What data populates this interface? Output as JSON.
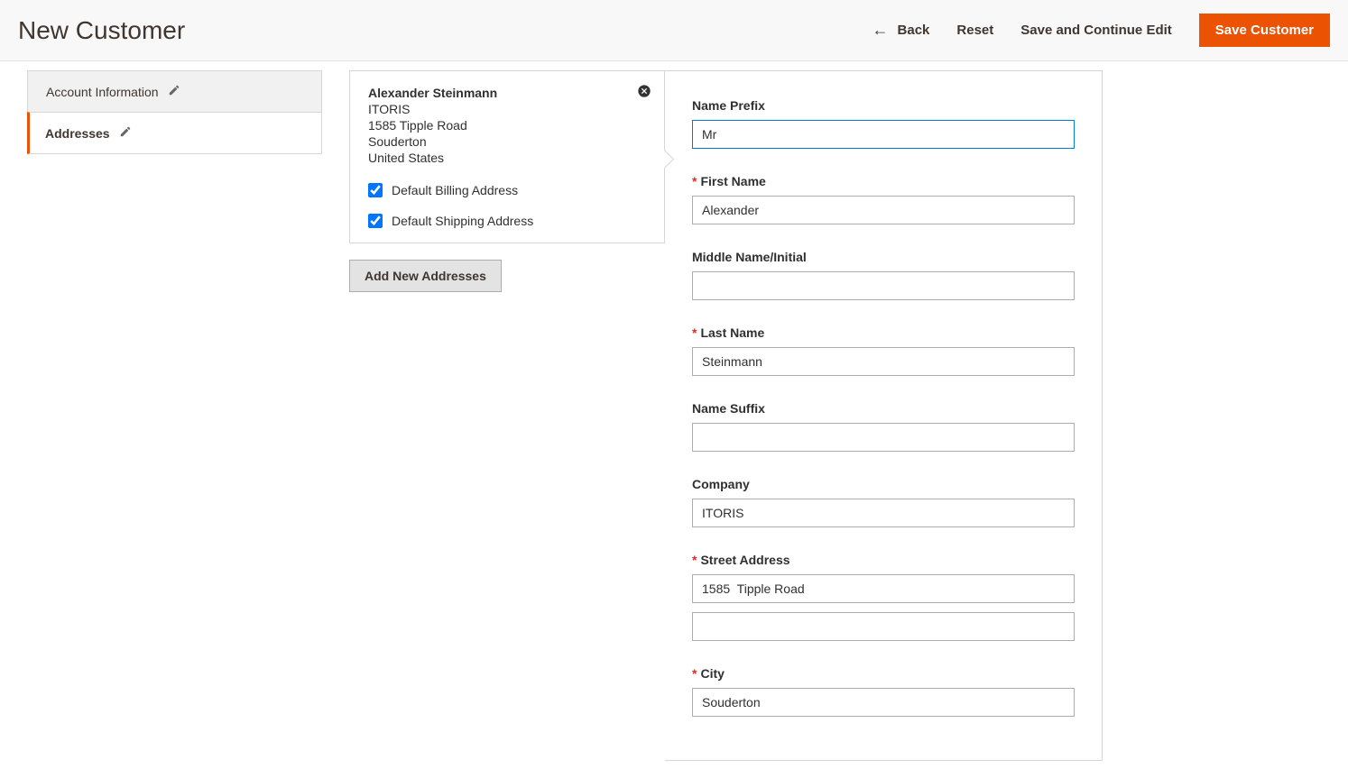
{
  "header": {
    "title": "New Customer",
    "actions": {
      "back": "Back",
      "reset": "Reset",
      "save_continue": "Save and Continue Edit",
      "save": "Save Customer"
    }
  },
  "sidebar": {
    "items": [
      {
        "label": "Account Information"
      },
      {
        "label": "Addresses"
      }
    ]
  },
  "address_card": {
    "name": "Alexander Steinmann",
    "company": "ITORIS",
    "street": "1585 Tipple Road",
    "city": "Souderton",
    "country": "United States",
    "default_billing_label": "Default Billing Address",
    "default_shipping_label": "Default Shipping Address",
    "default_billing_checked": true,
    "default_shipping_checked": true
  },
  "buttons": {
    "add_new_addresses": "Add New Addresses"
  },
  "form": {
    "name_prefix": {
      "label": "Name Prefix",
      "value": "Mr",
      "required": false
    },
    "first_name": {
      "label": "First Name",
      "value": "Alexander",
      "required": true
    },
    "middle_name": {
      "label": "Middle Name/Initial",
      "value": "",
      "required": false
    },
    "last_name": {
      "label": "Last Name",
      "value": "Steinmann",
      "required": true
    },
    "name_suffix": {
      "label": "Name Suffix",
      "value": "",
      "required": false
    },
    "company": {
      "label": "Company",
      "value": "ITORIS",
      "required": false
    },
    "street": {
      "label": "Street Address",
      "value1": "1585  Tipple Road",
      "value2": "",
      "required": true
    },
    "city": {
      "label": "City",
      "value": "Souderton",
      "required": true
    }
  }
}
